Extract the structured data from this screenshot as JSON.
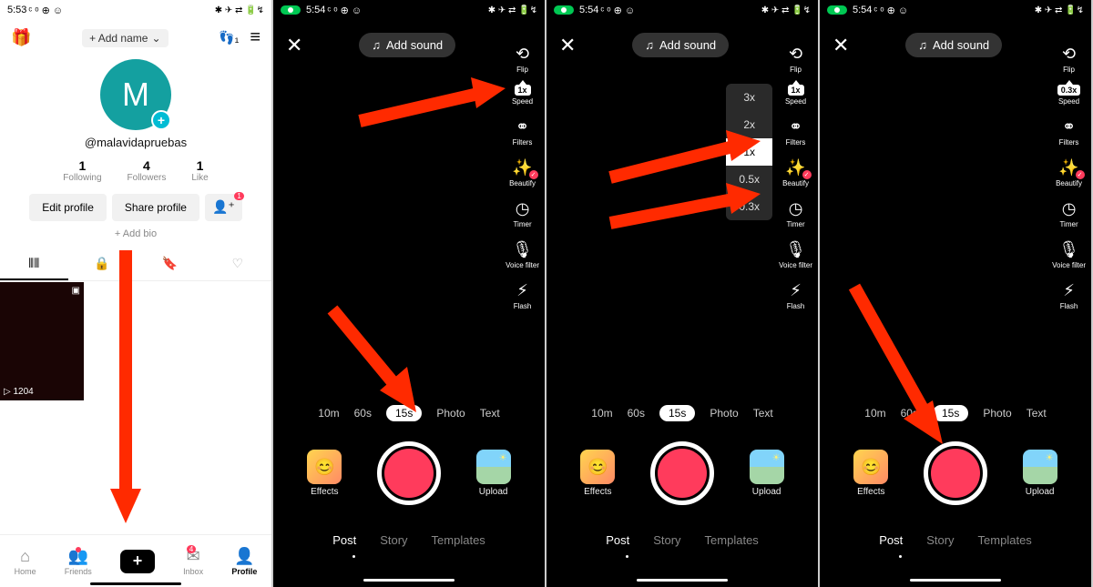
{
  "status": {
    "time_profile": "5:53",
    "time_cam": "5:54",
    "icons_left": "ᶜ ᵒ ⊕ ☺",
    "icons_right": "✱ ✈ ⇄ 🔋↯"
  },
  "profile": {
    "add_name": "+ Add name",
    "avatar_letter": "M",
    "username": "@malavidapruebas",
    "stats": [
      {
        "num": "1",
        "label": "Following"
      },
      {
        "num": "4",
        "label": "Followers"
      },
      {
        "num": "1",
        "label": "Like"
      }
    ],
    "edit": "Edit profile",
    "share": "Share profile",
    "add_friends_badge": "1",
    "add_bio": "+ Add bio",
    "thumb_views": "▷ 1204",
    "nav": {
      "home": "Home",
      "friends": "Friends",
      "inbox": "Inbox",
      "inbox_badge": "4",
      "profile": "Profile"
    }
  },
  "camera": {
    "add_sound": "Add sound",
    "tools": {
      "flip": "Flip",
      "speed": "Speed",
      "filters": "Filters",
      "beautify": "Beautify",
      "timer": "Timer",
      "voice": "Voice filter",
      "flash": "Flash"
    },
    "speed_label_default": "1x",
    "speed_label_alt": "0.3x",
    "speed_options": [
      "3x",
      "2x",
      "1x",
      "0.5x",
      "0.3x"
    ],
    "speed_selected": "1x",
    "durations": [
      "10m",
      "60s",
      "15s",
      "Photo",
      "Text"
    ],
    "duration_selected": "15s",
    "effects": "Effects",
    "upload": "Upload",
    "modes": [
      "Post",
      "Story",
      "Templates"
    ],
    "mode_selected": "Post"
  }
}
